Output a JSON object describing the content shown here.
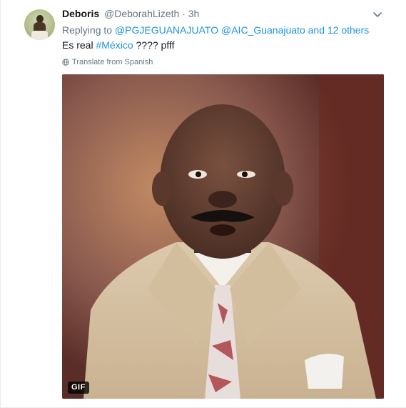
{
  "tweet": {
    "author_name": "Deboris",
    "author_handle": "@DeborahLizeth",
    "separator": "·",
    "timestamp": "3h",
    "replying_prefix": "Replying to ",
    "replying_user_1": "@PGJEGUANAJUATO",
    "replying_user_2": "@AIC_Guanajuato",
    "replying_suffix": " and 12 others",
    "text_before": "Es real ",
    "hashtag": "#México",
    "text_after": " ???? pfff",
    "translate_label": "Translate from Spanish",
    "media_badge": "GIF"
  },
  "icons": {
    "caret": "chevron-down-icon",
    "translate": "globe-icon",
    "avatar": "avatar"
  },
  "colors": {
    "link": "#1b95e0",
    "secondary_text": "#657786",
    "primary_text": "#14171a"
  }
}
